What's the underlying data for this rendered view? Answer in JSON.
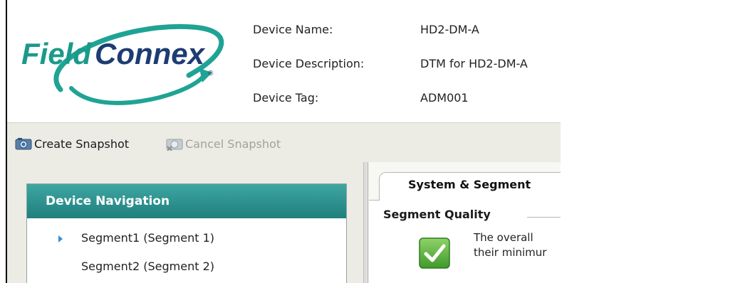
{
  "logo": {
    "brand_text": "FieldConnex",
    "colors": {
      "field": "#1a9a8a",
      "connex": "#1c3d72",
      "swoosh": "#1fa394"
    }
  },
  "device_info": {
    "name_label": "Device Name:",
    "name_value": "HD2-DM-A",
    "description_label": "Device Description:",
    "description_value": "DTM for HD2-DM-A",
    "tag_label": "Device Tag:",
    "tag_value": "ADM001"
  },
  "toolbar": {
    "create_snapshot_label": "Create Snapshot",
    "create_snapshot_icon": "camera-icon",
    "cancel_snapshot_label": "Cancel Snapshot",
    "cancel_snapshot_icon": "camera-cancel-icon"
  },
  "navigation": {
    "title": "Device Navigation",
    "items": [
      {
        "label": "Segment1 (Segment 1)",
        "selected": true
      },
      {
        "label": "Segment2 (Segment 2)",
        "selected": false
      }
    ]
  },
  "right_panel": {
    "tab_label": "System & Segment",
    "section_title": "Segment Quality",
    "status_icon": "check-icon",
    "quality_lines": [
      "The overall",
      "their minimur"
    ]
  }
}
